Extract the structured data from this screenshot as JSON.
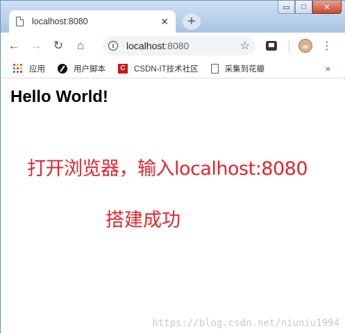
{
  "window": {
    "controls": {
      "minimize": "▭",
      "maximize": "□",
      "close": "✕"
    }
  },
  "tab": {
    "title": "localhost:8080",
    "close": "✕",
    "new_tab": "+"
  },
  "toolbar": {
    "back": "←",
    "forward": "→",
    "reload": "↻",
    "home": "⌂",
    "url_host": "localhost",
    "url_port": ":8080",
    "info_icon": "i",
    "star": "☆",
    "menu": "⋮"
  },
  "bookmarks": {
    "items": [
      {
        "label": "应用",
        "icon": "apps-icon"
      },
      {
        "label": "用户脚本",
        "icon": "github-icon"
      },
      {
        "label": "CSDN-IT技术社区",
        "icon": "csdn-icon",
        "icon_text": "C"
      },
      {
        "label": "采集到花瓣",
        "icon": "page-icon"
      }
    ],
    "more": "»",
    "apps_colors": [
      "#ea4335",
      "#fbbc05",
      "#34a853",
      "#4285f4",
      "#ea4335",
      "#fbbc05",
      "#34a853",
      "#4285f4",
      "#ea4335"
    ]
  },
  "page": {
    "heading": "Hello World!",
    "line1": "打开浏览器，输入localhost:8080",
    "line2": "搭建成功",
    "watermark": "https://blog.csdn.net/niuniu1994",
    "accent_color": "#e0262f"
  }
}
